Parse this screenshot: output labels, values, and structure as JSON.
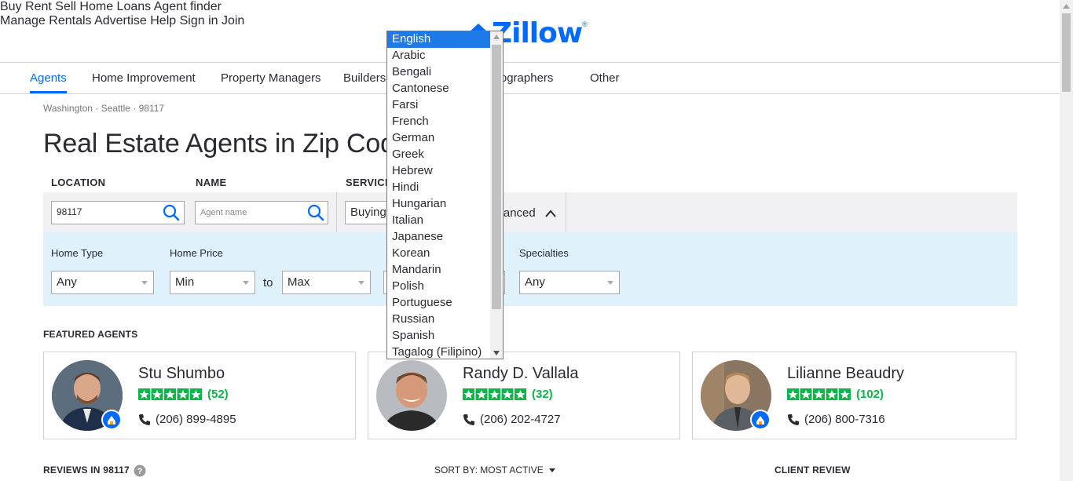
{
  "header": {
    "nav_left": [
      "Buy",
      "Rent",
      "Sell",
      "Home Loans",
      "Agent finder"
    ],
    "logo_text": "Zillow",
    "logo_reg": "®",
    "nav_right": [
      "Manage Rentals",
      "Advertise",
      "Help",
      "Sign in",
      "Join"
    ]
  },
  "sub_nav": {
    "items": [
      "Agents",
      "Home Improvement",
      "Property Managers",
      "Builders",
      "Photographers",
      "Other"
    ],
    "active": "Agents"
  },
  "breadcrumb": "Washington · Seattle · 98117",
  "page_title": "Real Estate Agents in Zip Code 98117",
  "search": {
    "location_label": "LOCATION",
    "location_value": "98117",
    "name_label": "NAME",
    "name_placeholder": "Agent name",
    "service_label": "SERVICE",
    "service_value": "Buying",
    "advanced_label": "Advanced"
  },
  "advanced": {
    "home_type_label": "Home Type",
    "home_type_value": "Any",
    "home_price_label": "Home Price",
    "min_value": "Min",
    "to_label": "to",
    "max_value": "Max",
    "specialties_label": "Specialties",
    "specialties_value": "Any"
  },
  "featured_heading": "FEATURED AGENTS",
  "agents": [
    {
      "name": "Stu Shumbo",
      "reviews": "(52)",
      "phone": "(206) 899-4895"
    },
    {
      "name": "Randy D. Vallala",
      "reviews": "(32)",
      "phone": "(206) 202-4727"
    },
    {
      "name": "Lilianne Beaudry",
      "reviews": "(102)",
      "phone": "(206) 800-7316"
    }
  ],
  "reviews_heading": "REVIEWS IN 98117",
  "sort_label": "SORT BY: MOST ACTIVE",
  "client_review_heading": "CLIENT REVIEW",
  "language_dropdown": {
    "selected": "English",
    "options": [
      "English",
      "Arabic",
      "Bengali",
      "Cantonese",
      "Farsi",
      "French",
      "German",
      "Greek",
      "Hebrew",
      "Hindi",
      "Hungarian",
      "Italian",
      "Japanese",
      "Korean",
      "Mandarin",
      "Polish",
      "Portuguese",
      "Russian",
      "Spanish",
      "Tagalog (Filipino)"
    ]
  },
  "colors": {
    "brand": "#006aff",
    "star": "#0fb44b",
    "advanced_bg": "#dff2fc",
    "selected_option": "#1e7ae6"
  }
}
